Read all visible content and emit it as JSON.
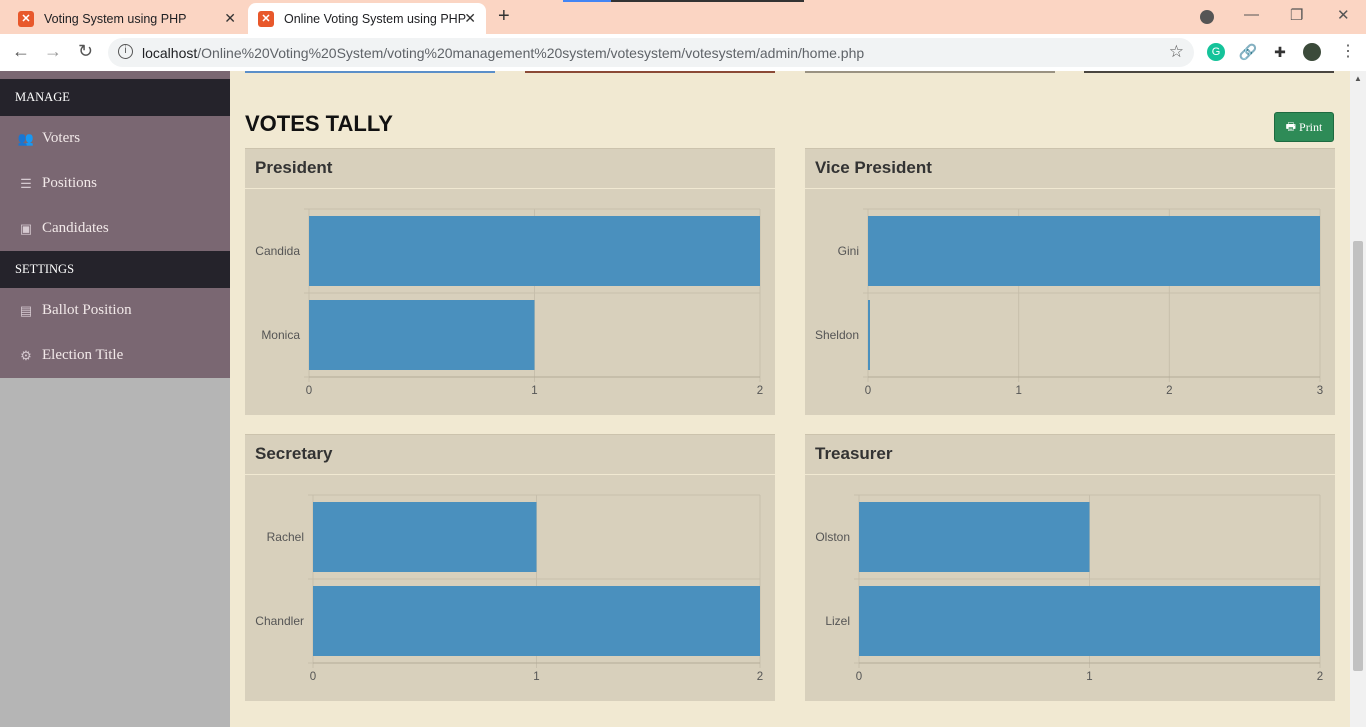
{
  "browser": {
    "tabs": [
      {
        "title": "Voting System using PHP",
        "active": false
      },
      {
        "title": "Online Voting System using PHP",
        "active": true
      }
    ],
    "url_host": "localhost",
    "url_path": "/Online%20Voting%20System/voting%20management%20system/votesystem/votesystem/admin/home.php"
  },
  "sidebar": {
    "sections": [
      {
        "header": "MANAGE",
        "items": [
          {
            "label": "Voters",
            "icon": "users-icon"
          },
          {
            "label": "Positions",
            "icon": "tasks-icon"
          },
          {
            "label": "Candidates",
            "icon": "candidate-icon"
          }
        ]
      },
      {
        "header": "SETTINGS",
        "items": [
          {
            "label": "Ballot Position",
            "icon": "file-icon"
          },
          {
            "label": "Election Title",
            "icon": "cogs-icon"
          }
        ]
      }
    ]
  },
  "main": {
    "title": "VOTES TALLY",
    "print_label": "Print"
  },
  "colors": {
    "bar": "#4a90be",
    "panel": "#d8d0bc",
    "background": "#f1e9d2",
    "sidebar_item": "#7a6772",
    "sidebar_header": "#25232b",
    "print_button": "#2e8b57"
  },
  "chart_data": [
    {
      "type": "bar",
      "orientation": "horizontal",
      "title": "President",
      "categories": [
        "Candida",
        "Monica"
      ],
      "values": [
        2,
        1
      ],
      "xlim": [
        0,
        2
      ],
      "ticks": [
        0,
        1,
        2
      ]
    },
    {
      "type": "bar",
      "orientation": "horizontal",
      "title": "Vice President",
      "categories": [
        "Gini",
        "Sheldon"
      ],
      "values": [
        3,
        0
      ],
      "xlim": [
        0,
        3
      ],
      "ticks": [
        0,
        1,
        2,
        3
      ]
    },
    {
      "type": "bar",
      "orientation": "horizontal",
      "title": "Secretary",
      "categories": [
        "Rachel",
        "Chandler"
      ],
      "values": [
        1,
        2
      ],
      "xlim": [
        0,
        2
      ],
      "ticks": [
        0,
        1,
        2
      ]
    },
    {
      "type": "bar",
      "orientation": "horizontal",
      "title": "Treasurer",
      "categories": [
        "Olston",
        "Lizel"
      ],
      "values": [
        1,
        2
      ],
      "xlim": [
        0,
        2
      ],
      "ticks": [
        0,
        1,
        2
      ]
    }
  ]
}
